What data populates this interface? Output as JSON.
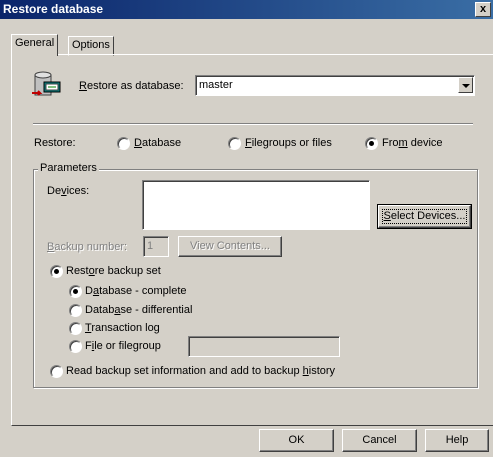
{
  "window": {
    "title": "Restore database",
    "close_label": "x"
  },
  "tabs": [
    {
      "label": "General",
      "active": true
    },
    {
      "label": "Options",
      "active": false
    }
  ],
  "restore_as": {
    "label_pre": "",
    "label_u": "R",
    "label_post": "estore as database:",
    "value": "master"
  },
  "restore": {
    "label": "Restore:",
    "options": [
      {
        "u": "D",
        "rest": "atabase",
        "pre": "",
        "checked": false
      },
      {
        "u": "F",
        "rest": "ilegroups or files",
        "pre": "",
        "checked": false
      },
      {
        "pre": "Fro",
        "u": "m",
        "rest": " device",
        "checked": true
      }
    ]
  },
  "parameters": {
    "title": "Parameters",
    "devices_label_pre": "De",
    "devices_label_u": "v",
    "devices_label_post": "ices:",
    "select_devices_pre": "",
    "select_devices_u": "S",
    "select_devices_post": "elect Devices...",
    "backup_number_label_u": "B",
    "backup_number_label_post": "ackup number:",
    "backup_number_value": "1",
    "view_contents_label": "View Contents...",
    "restore_backup_set": {
      "pre": "Rest",
      "u": "o",
      "post": "re backup set",
      "checked": true
    },
    "backup_types": [
      {
        "pre": "D",
        "u": "a",
        "post": "tabase - complete",
        "checked": true
      },
      {
        "pre": "Datab",
        "u": "a",
        "post": "se - differential",
        "checked": false
      },
      {
        "pre": "",
        "u": "T",
        "post": "ransaction log",
        "checked": false
      },
      {
        "pre": "F",
        "u": "i",
        "post": "le or filegroup",
        "checked": false
      }
    ],
    "read_backup": {
      "pre": "Read backup set information and add to backup ",
      "u": "h",
      "post": "istory",
      "checked": false
    }
  },
  "buttons": {
    "ok": "OK",
    "cancel": "Cancel",
    "help": "Help"
  }
}
